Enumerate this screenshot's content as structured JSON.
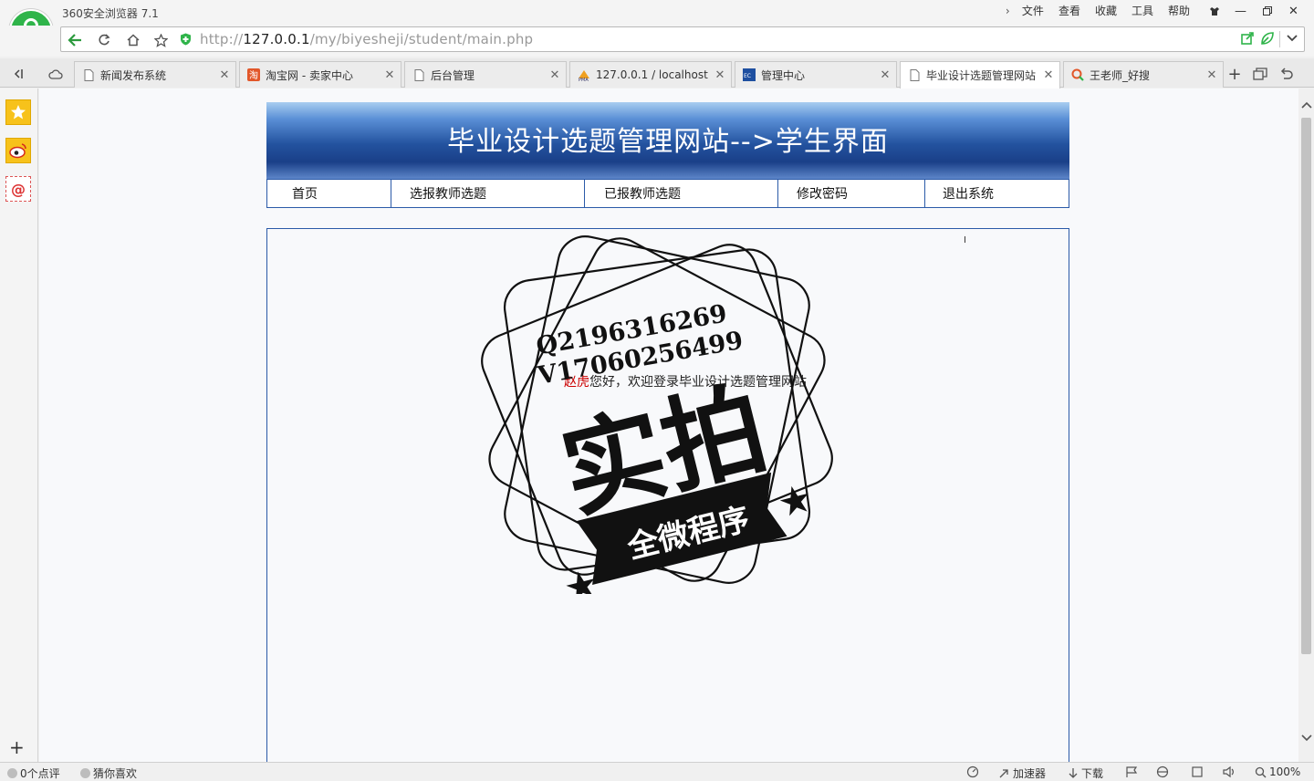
{
  "browser": {
    "app_title": "360安全浏览器 7.1",
    "menu": [
      "文件",
      "查看",
      "收藏",
      "工具",
      "帮助"
    ],
    "url_scheme": "http://",
    "url_host": "127.0.0.1",
    "url_path": "/my/biyesheji/student/main.php"
  },
  "tabs": [
    {
      "label": "新闻发布系统",
      "icon": "page-icon"
    },
    {
      "label": "淘宝网 - 卖家中心",
      "icon": "taobao-icon"
    },
    {
      "label": "后台管理",
      "icon": "page-icon"
    },
    {
      "label": "127.0.0.1 / localhost",
      "icon": "phpmyadmin-icon"
    },
    {
      "label": "管理中心",
      "icon": "ecshop-icon"
    },
    {
      "label": "毕业设计选题管理网站",
      "icon": "page-icon",
      "active": true
    },
    {
      "label": "王老师_好搜",
      "icon": "haosou-icon"
    }
  ],
  "site": {
    "banner_title": "毕业设计选题管理网站-->学生界面",
    "nav": [
      "首页",
      "选报教师选题",
      "已报教师选题",
      "修改密码",
      "退出系统"
    ],
    "welcome_user": "赵虎",
    "welcome_text": "您好，欢迎登录毕业设计选题管理网站"
  },
  "watermark": {
    "line1": "Q2196316269",
    "line2": "V17060256499",
    "big": "实拍",
    "ribbon": "全微程序"
  },
  "status": {
    "comments": "0个点评",
    "guess": "猜你喜欢",
    "accelerator": "加速器",
    "download": "下载",
    "zoom": "100%"
  },
  "colors": {
    "accent": "#2b5aa8",
    "logo": "#2fb44a"
  }
}
